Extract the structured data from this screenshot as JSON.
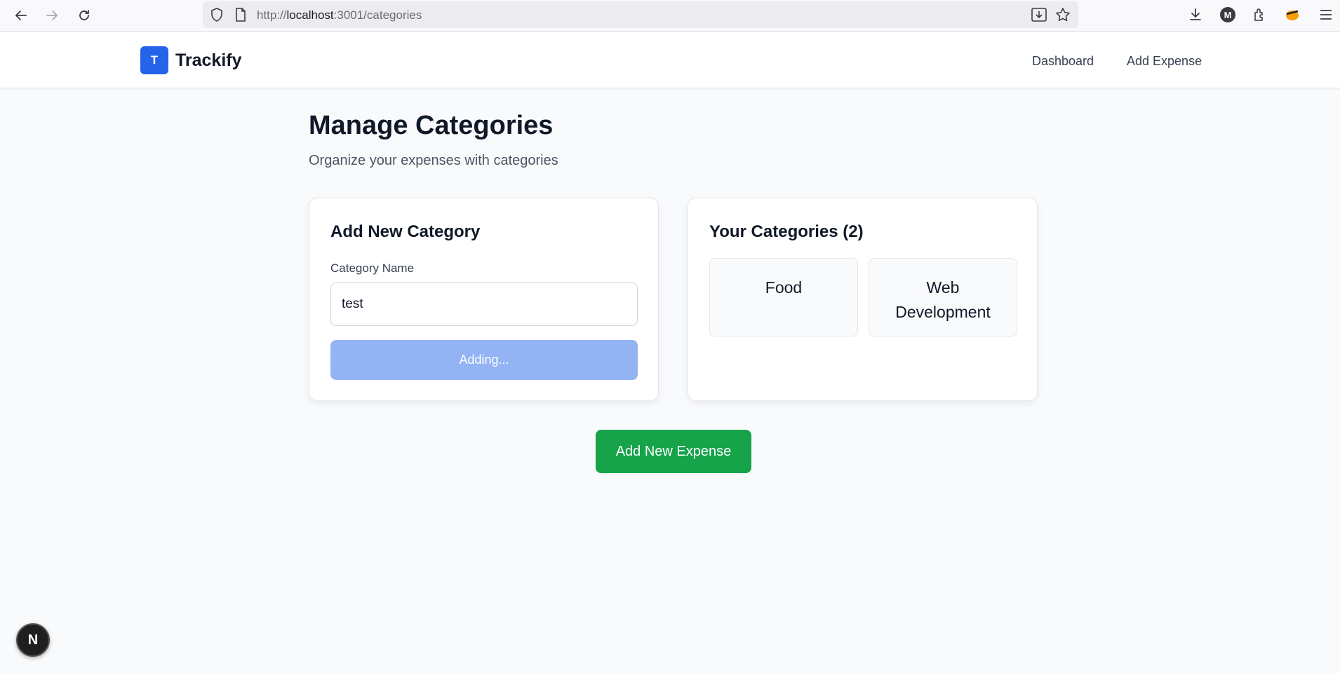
{
  "browser": {
    "url_prefix": "http://",
    "url_host": "localhost",
    "url_rest": ":3001/categories",
    "icons": [
      "back-arrow-icon",
      "forward-arrow-icon",
      "reload-icon",
      "shield-icon",
      "page-icon",
      "download-page-icon",
      "star-icon",
      "downloads-icon",
      "account-icon",
      "extensions-icon",
      "profile-icon",
      "menu-icon"
    ],
    "account_initial": "M"
  },
  "header": {
    "logo_letter": "T",
    "brand": "Trackify",
    "nav": [
      {
        "label": "Dashboard"
      },
      {
        "label": "Add Expense"
      }
    ]
  },
  "main": {
    "title": "Manage Categories",
    "subtitle": "Organize your expenses with categories",
    "add_card": {
      "title": "Add New Category",
      "field_label": "Category Name",
      "input_value": "test",
      "button_label": "Adding..."
    },
    "list_card": {
      "title": "Your Categories (2)",
      "categories": [
        {
          "name": "Food"
        },
        {
          "name": "Web Development"
        }
      ]
    },
    "add_expense_button": "Add New Expense"
  },
  "dev_badge": "N",
  "colors": {
    "primary": "#2563eb",
    "primary_disabled": "#93b3f5",
    "success": "#16a34a"
  }
}
